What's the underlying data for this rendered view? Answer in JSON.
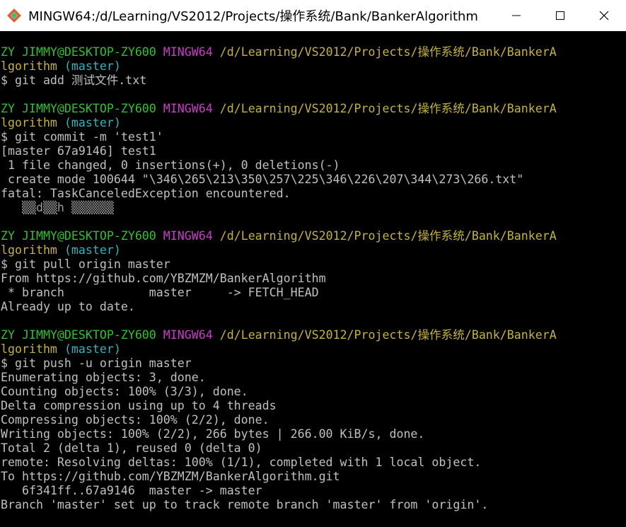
{
  "window": {
    "title": "MINGW64:/d/Learning/VS2012/Projects/操作系统/Bank/BankerAlgorithm",
    "app_icon": "git-bash-icon",
    "controls": [
      "minimize-icon",
      "maximize-icon",
      "close-icon"
    ]
  },
  "colors": {
    "user": "#2fc12f",
    "msystem": "#c93cc9",
    "path": "#c4b33a",
    "branch": "#2fb5bd",
    "text": "#c0c0c0",
    "background": "#000000"
  },
  "prompt": {
    "user": "ZY JIMMY@DESKTOP-ZY600",
    "msystem": "MINGW64",
    "path": "/d/Learning/VS2012/Projects/操作系统/Bank/BankerA",
    "path_wrap": "lgorithm",
    "branch": "(master)"
  },
  "blocks": [
    {
      "command": "$ git add 测试文件.txt",
      "output": []
    },
    {
      "command": "$ git commit -m 'test1'",
      "output": [
        "[master 67a9146] test1",
        " 1 file changed, 0 insertions(+), 0 deletions(-)",
        " create mode 100644 \"\\346\\265\\213\\350\\257\\225\\346\\226\\207\\344\\273\\266.txt\"",
        "fatal: TaskCanceledException encountered.",
        "   ▒▒d▒▒h ▒▒▒▒▒▒"
      ]
    },
    {
      "command": "$ git pull origin master",
      "output": [
        "From https://github.com/YBZMZM/BankerAlgorithm",
        " * branch            master     -> FETCH_HEAD",
        "Already up to date."
      ]
    },
    {
      "command": "$ git push -u origin master",
      "output": [
        "Enumerating objects: 3, done.",
        "Counting objects: 100% (3/3), done.",
        "Delta compression using up to 4 threads",
        "Compressing objects: 100% (2/2), done.",
        "Writing objects: 100% (2/2), 266 bytes | 266.00 KiB/s, done.",
        "Total 2 (delta 1), reused 0 (delta 0)",
        "remote: Resolving deltas: 100% (1/1), completed with 1 local object.",
        "To https://github.com/YBZMZM/BankerAlgorithm.git",
        "   6f341ff..67a9146  master -> master",
        "Branch 'master' set up to track remote branch 'master' from 'origin'."
      ]
    }
  ]
}
